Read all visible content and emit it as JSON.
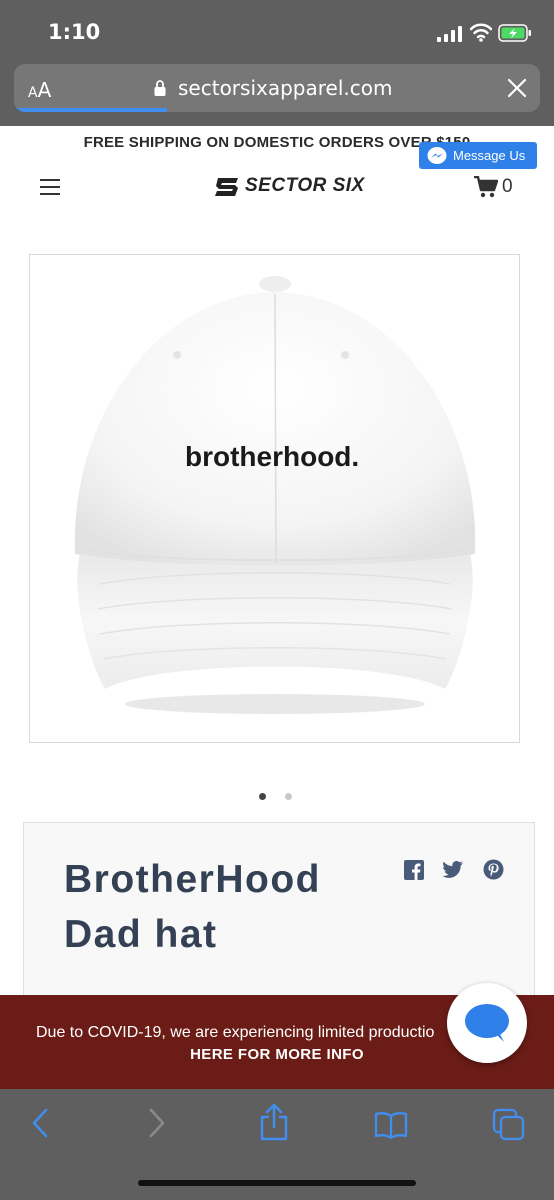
{
  "status_bar": {
    "time": "1:10"
  },
  "browser": {
    "text_size_label": "AA",
    "url": "sectorsixapparel.com",
    "load_progress": 0.29
  },
  "site": {
    "promo": "FREE SHIPPING ON DOMESTIC ORDERS OVER $150",
    "messenger_label": "Message Us",
    "brand": "SECTOR SIX",
    "cart_count": "0"
  },
  "product": {
    "image_text": "brotherhood.",
    "carousel": {
      "total": 2,
      "active": 1
    },
    "title_line1": "BrotherHood",
    "title_line2": "Dad hat"
  },
  "banner": {
    "line1": "Due to COVID-19, we are experiencing limited productio",
    "line2": "HERE FOR MORE INFO",
    "background": "#6b1c17"
  },
  "colors": {
    "accent": "#2f80e8",
    "chrome": "#5f5f5f"
  },
  "icons": [
    "lock-icon",
    "close-icon",
    "hamburger-icon",
    "cart-icon",
    "facebook-icon",
    "twitter-icon",
    "pinterest-icon",
    "chat-icon",
    "back-icon",
    "forward-icon",
    "share-icon",
    "bookmarks-icon",
    "tabs-icon"
  ]
}
